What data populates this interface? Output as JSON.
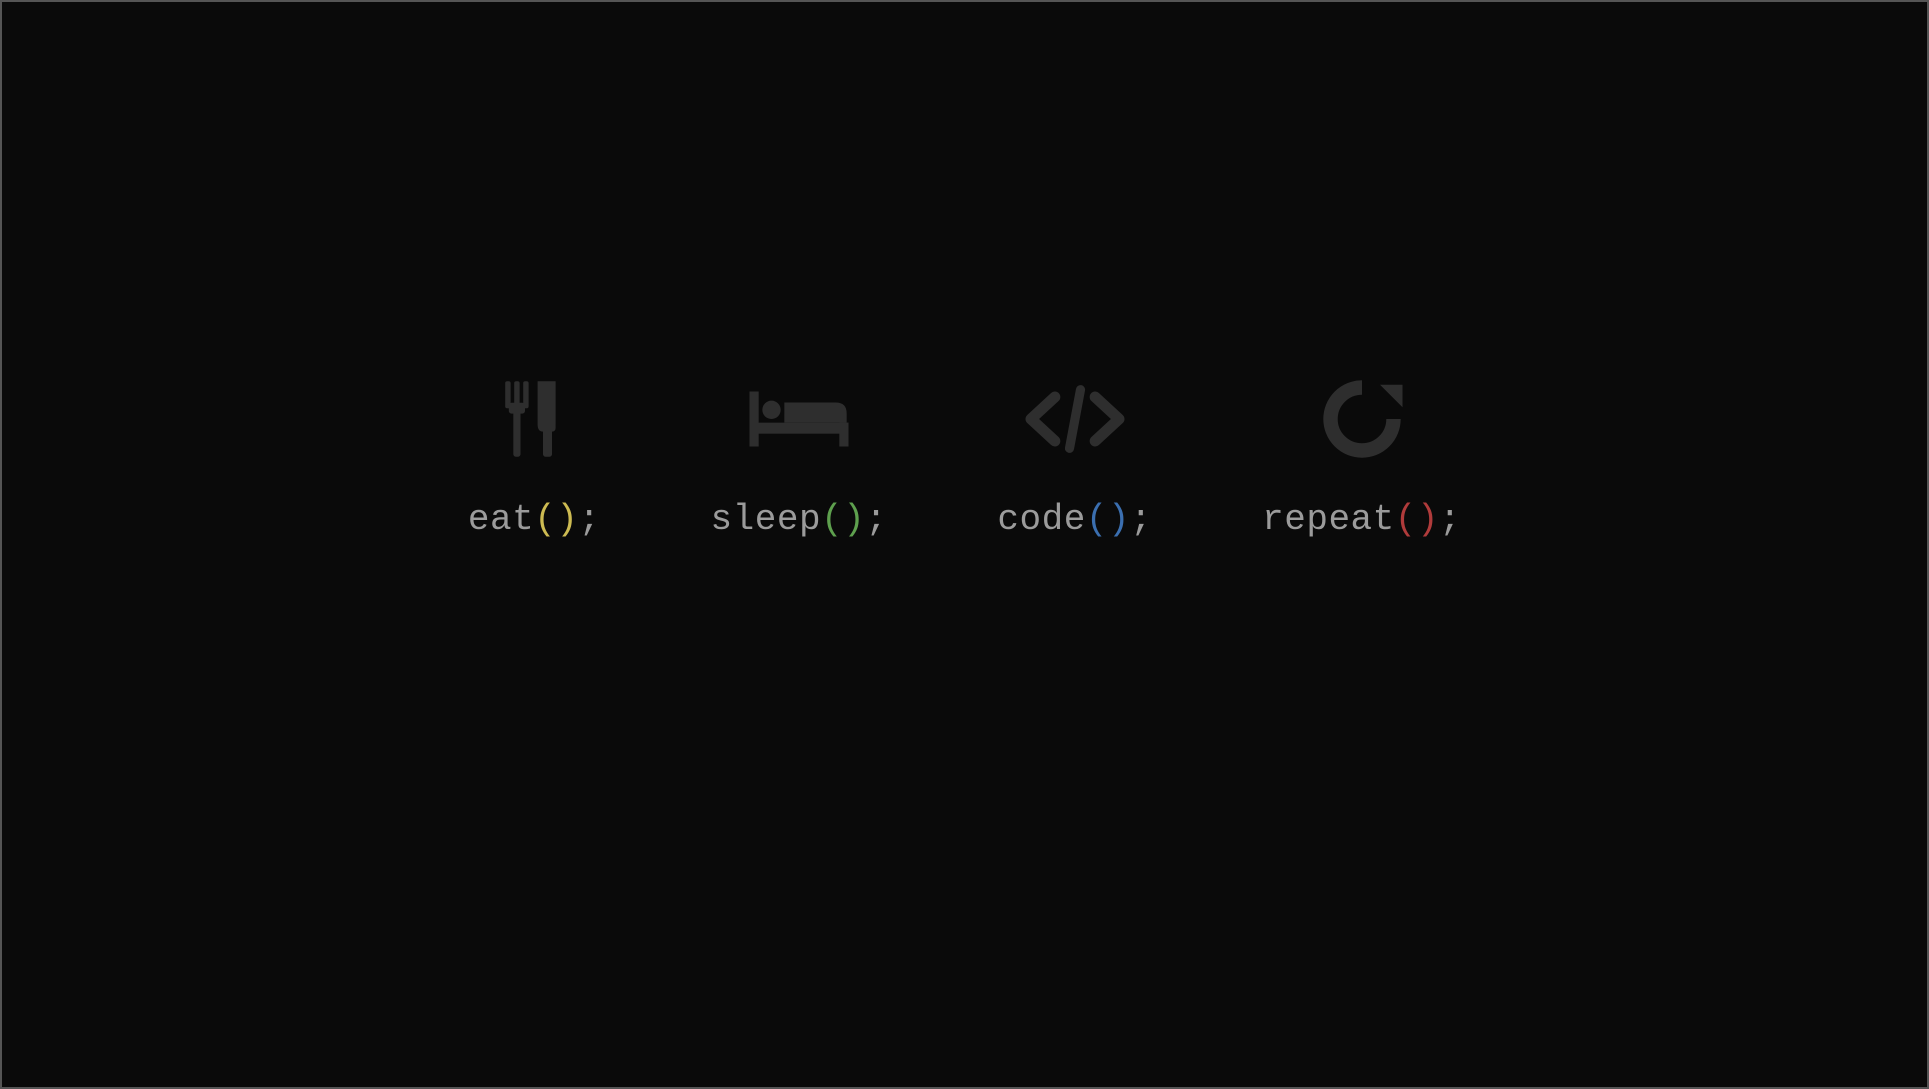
{
  "items": [
    {
      "word": "eat",
      "paren_color": "#cdbb52",
      "icon": "utensils"
    },
    {
      "word": "sleep",
      "paren_color": "#5ea04e",
      "icon": "bed"
    },
    {
      "word": "code",
      "paren_color": "#3b6fb0",
      "icon": "code"
    },
    {
      "word": "repeat",
      "paren_color": "#b03b3b",
      "icon": "refresh"
    }
  ],
  "colors": {
    "background": "#0a0a0a",
    "icon": "#2e2e2e",
    "text": "#9b9b9b"
  }
}
